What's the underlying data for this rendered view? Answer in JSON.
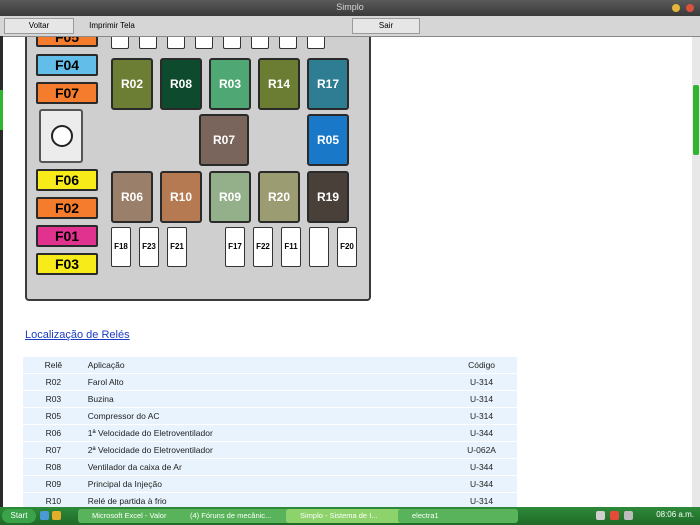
{
  "window": {
    "title": "Simplo"
  },
  "toolbar": {
    "back": "Voltar",
    "print": "Imprimir Tela",
    "exit": "Sair"
  },
  "fusebox": {
    "fuses": [
      {
        "label": "F05",
        "color": "#f47c2c"
      },
      {
        "label": "F04",
        "color": "#62bde8"
      },
      {
        "label": "F07",
        "color": "#f47c2c"
      },
      {
        "label": "F06",
        "color": "#f7ec1a"
      },
      {
        "label": "F02",
        "color": "#f47c2c"
      },
      {
        "label": "F01",
        "color": "#e23290"
      },
      {
        "label": "F03",
        "color": "#f7ec1a"
      }
    ],
    "relays": [
      {
        "label": "R02",
        "color": "#6c7d34"
      },
      {
        "label": "R08",
        "color": "#0e4a2e"
      },
      {
        "label": "R03",
        "color": "#4fa873"
      },
      {
        "label": "R14",
        "color": "#6b7d33"
      },
      {
        "label": "R17",
        "color": "#2e7d92"
      },
      {
        "label": "R07",
        "color": "#7a655c"
      },
      {
        "label": "R05",
        "color": "#1a78c8"
      },
      {
        "label": "R06",
        "color": "#9a7f6a"
      },
      {
        "label": "R10",
        "color": "#b57a52"
      },
      {
        "label": "R09",
        "color": "#94b08a"
      },
      {
        "label": "R20",
        "color": "#9c9c72"
      },
      {
        "label": "R19",
        "color": "#4a403a"
      }
    ],
    "small_fuses": [
      "F18",
      "F23",
      "F21",
      "F17",
      "F22",
      "F11",
      "",
      "F20"
    ]
  },
  "link": {
    "text": "Localização de Relés"
  },
  "table": {
    "headers": [
      "Relê",
      "Aplicação",
      "Código"
    ],
    "rows": [
      [
        "R02",
        "Farol Alto",
        "U-314"
      ],
      [
        "R03",
        "Buzina",
        "U-314"
      ],
      [
        "R05",
        "Compressor do AC",
        "U-314"
      ],
      [
        "R06",
        "1ª Velocidade do Eletroventilador",
        "U-344"
      ],
      [
        "R07",
        "2ª Velocidade do Eletroventilador",
        "U-062A"
      ],
      [
        "R08",
        "Ventilador da caixa de Ar",
        "U-344"
      ],
      [
        "R09",
        "Principal da Injeção",
        "U-344"
      ],
      [
        "R10",
        "Relé de partida à frio",
        "U-314"
      ]
    ]
  },
  "taskbar": {
    "start": "Start",
    "tasks": [
      "Microsoft Excel - Valor",
      "(4) Fóruns de mecânic...",
      "Simplo - Sistema de I...",
      "electra1"
    ],
    "clock": "08:06 a.m."
  }
}
